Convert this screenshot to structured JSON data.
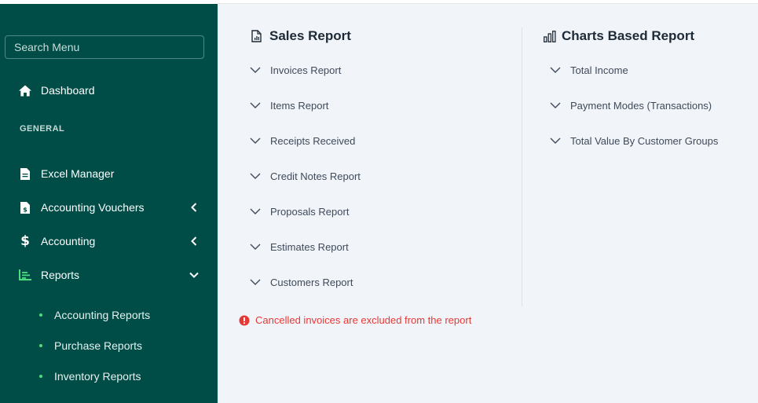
{
  "sidebar": {
    "search_placeholder": "Search Menu",
    "dashboard": "Dashboard",
    "section_general": "GENERAL",
    "items": [
      {
        "label": "Excel Manager"
      },
      {
        "label": "Accounting Vouchers"
      },
      {
        "label": "Accounting"
      },
      {
        "label": "Reports"
      }
    ],
    "reports_sub": [
      {
        "label": "Accounting Reports"
      },
      {
        "label": "Purchase Reports"
      },
      {
        "label": "Inventory Reports"
      }
    ]
  },
  "sales": {
    "title": "Sales Report",
    "items": [
      "Invoices Report",
      "Items Report",
      "Receipts Received",
      "Credit Notes Report",
      "Proposals Report",
      "Estimates Report",
      "Customers Report"
    ]
  },
  "charts": {
    "title": "Charts Based Report",
    "items": [
      "Total Income",
      "Payment Modes (Transactions)",
      "Total Value By Customer Groups"
    ]
  },
  "notice": "Cancelled invoices are excluded from the report",
  "colors": {
    "sidebar_bg": "#004d47",
    "main_bg": "#f1f4f9",
    "accent": "#4ade80",
    "warning": "#e53935"
  }
}
